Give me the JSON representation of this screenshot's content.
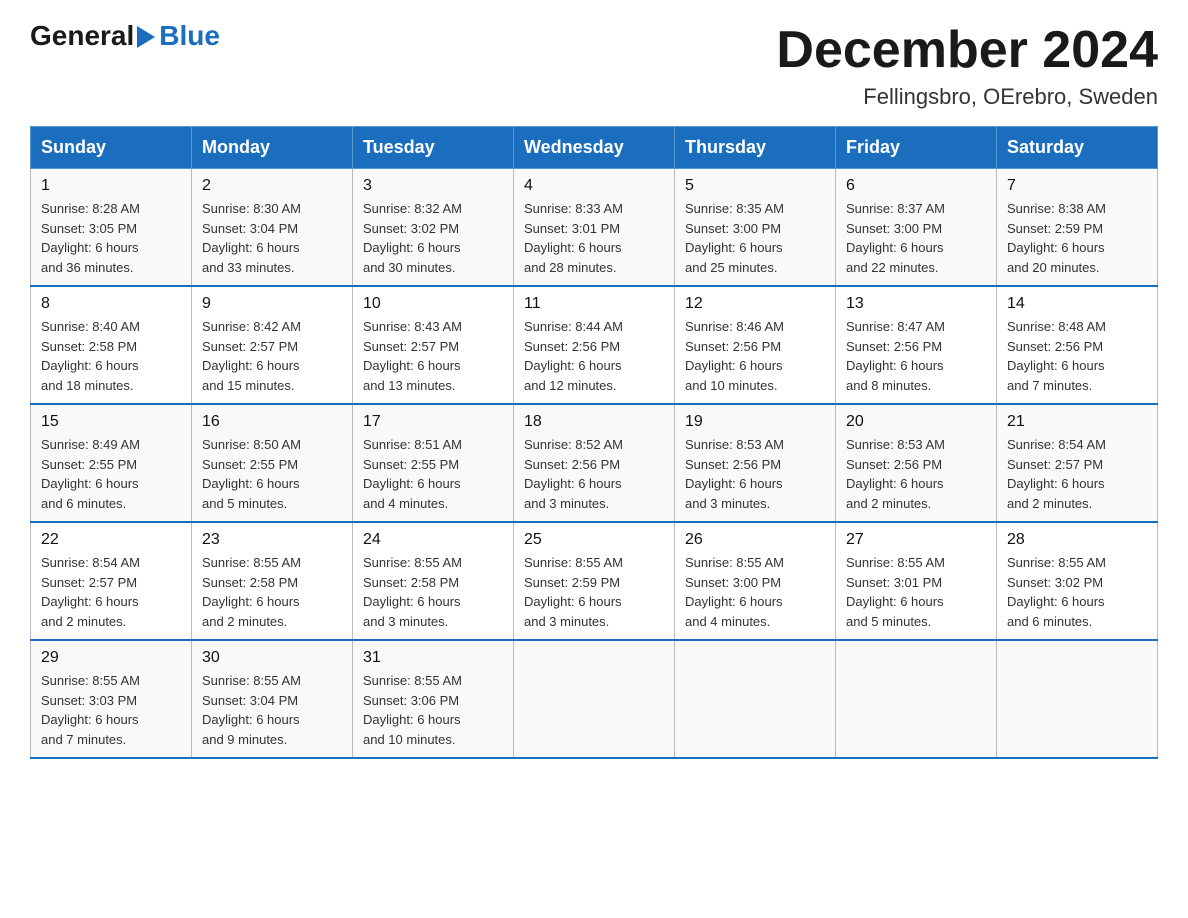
{
  "logo": {
    "general": "General",
    "blue": "Blue",
    "tagline": ""
  },
  "title": {
    "month_year": "December 2024",
    "location": "Fellingsbro, OErebro, Sweden"
  },
  "headers": [
    "Sunday",
    "Monday",
    "Tuesday",
    "Wednesday",
    "Thursday",
    "Friday",
    "Saturday"
  ],
  "weeks": [
    [
      {
        "day": "1",
        "sunrise": "8:28 AM",
        "sunset": "3:05 PM",
        "daylight": "6 hours and 36 minutes."
      },
      {
        "day": "2",
        "sunrise": "8:30 AM",
        "sunset": "3:04 PM",
        "daylight": "6 hours and 33 minutes."
      },
      {
        "day": "3",
        "sunrise": "8:32 AM",
        "sunset": "3:02 PM",
        "daylight": "6 hours and 30 minutes."
      },
      {
        "day": "4",
        "sunrise": "8:33 AM",
        "sunset": "3:01 PM",
        "daylight": "6 hours and 28 minutes."
      },
      {
        "day": "5",
        "sunrise": "8:35 AM",
        "sunset": "3:00 PM",
        "daylight": "6 hours and 25 minutes."
      },
      {
        "day": "6",
        "sunrise": "8:37 AM",
        "sunset": "3:00 PM",
        "daylight": "6 hours and 22 minutes."
      },
      {
        "day": "7",
        "sunrise": "8:38 AM",
        "sunset": "2:59 PM",
        "daylight": "6 hours and 20 minutes."
      }
    ],
    [
      {
        "day": "8",
        "sunrise": "8:40 AM",
        "sunset": "2:58 PM",
        "daylight": "6 hours and 18 minutes."
      },
      {
        "day": "9",
        "sunrise": "8:42 AM",
        "sunset": "2:57 PM",
        "daylight": "6 hours and 15 minutes."
      },
      {
        "day": "10",
        "sunrise": "8:43 AM",
        "sunset": "2:57 PM",
        "daylight": "6 hours and 13 minutes."
      },
      {
        "day": "11",
        "sunrise": "8:44 AM",
        "sunset": "2:56 PM",
        "daylight": "6 hours and 12 minutes."
      },
      {
        "day": "12",
        "sunrise": "8:46 AM",
        "sunset": "2:56 PM",
        "daylight": "6 hours and 10 minutes."
      },
      {
        "day": "13",
        "sunrise": "8:47 AM",
        "sunset": "2:56 PM",
        "daylight": "6 hours and 8 minutes."
      },
      {
        "day": "14",
        "sunrise": "8:48 AM",
        "sunset": "2:56 PM",
        "daylight": "6 hours and 7 minutes."
      }
    ],
    [
      {
        "day": "15",
        "sunrise": "8:49 AM",
        "sunset": "2:55 PM",
        "daylight": "6 hours and 6 minutes."
      },
      {
        "day": "16",
        "sunrise": "8:50 AM",
        "sunset": "2:55 PM",
        "daylight": "6 hours and 5 minutes."
      },
      {
        "day": "17",
        "sunrise": "8:51 AM",
        "sunset": "2:55 PM",
        "daylight": "6 hours and 4 minutes."
      },
      {
        "day": "18",
        "sunrise": "8:52 AM",
        "sunset": "2:56 PM",
        "daylight": "6 hours and 3 minutes."
      },
      {
        "day": "19",
        "sunrise": "8:53 AM",
        "sunset": "2:56 PM",
        "daylight": "6 hours and 3 minutes."
      },
      {
        "day": "20",
        "sunrise": "8:53 AM",
        "sunset": "2:56 PM",
        "daylight": "6 hours and 2 minutes."
      },
      {
        "day": "21",
        "sunrise": "8:54 AM",
        "sunset": "2:57 PM",
        "daylight": "6 hours and 2 minutes."
      }
    ],
    [
      {
        "day": "22",
        "sunrise": "8:54 AM",
        "sunset": "2:57 PM",
        "daylight": "6 hours and 2 minutes."
      },
      {
        "day": "23",
        "sunrise": "8:55 AM",
        "sunset": "2:58 PM",
        "daylight": "6 hours and 2 minutes."
      },
      {
        "day": "24",
        "sunrise": "8:55 AM",
        "sunset": "2:58 PM",
        "daylight": "6 hours and 3 minutes."
      },
      {
        "day": "25",
        "sunrise": "8:55 AM",
        "sunset": "2:59 PM",
        "daylight": "6 hours and 3 minutes."
      },
      {
        "day": "26",
        "sunrise": "8:55 AM",
        "sunset": "3:00 PM",
        "daylight": "6 hours and 4 minutes."
      },
      {
        "day": "27",
        "sunrise": "8:55 AM",
        "sunset": "3:01 PM",
        "daylight": "6 hours and 5 minutes."
      },
      {
        "day": "28",
        "sunrise": "8:55 AM",
        "sunset": "3:02 PM",
        "daylight": "6 hours and 6 minutes."
      }
    ],
    [
      {
        "day": "29",
        "sunrise": "8:55 AM",
        "sunset": "3:03 PM",
        "daylight": "6 hours and 7 minutes."
      },
      {
        "day": "30",
        "sunrise": "8:55 AM",
        "sunset": "3:04 PM",
        "daylight": "6 hours and 9 minutes."
      },
      {
        "day": "31",
        "sunrise": "8:55 AM",
        "sunset": "3:06 PM",
        "daylight": "6 hours and 10 minutes."
      },
      null,
      null,
      null,
      null
    ]
  ],
  "labels": {
    "sunrise": "Sunrise:",
    "sunset": "Sunset:",
    "daylight": "Daylight:"
  }
}
